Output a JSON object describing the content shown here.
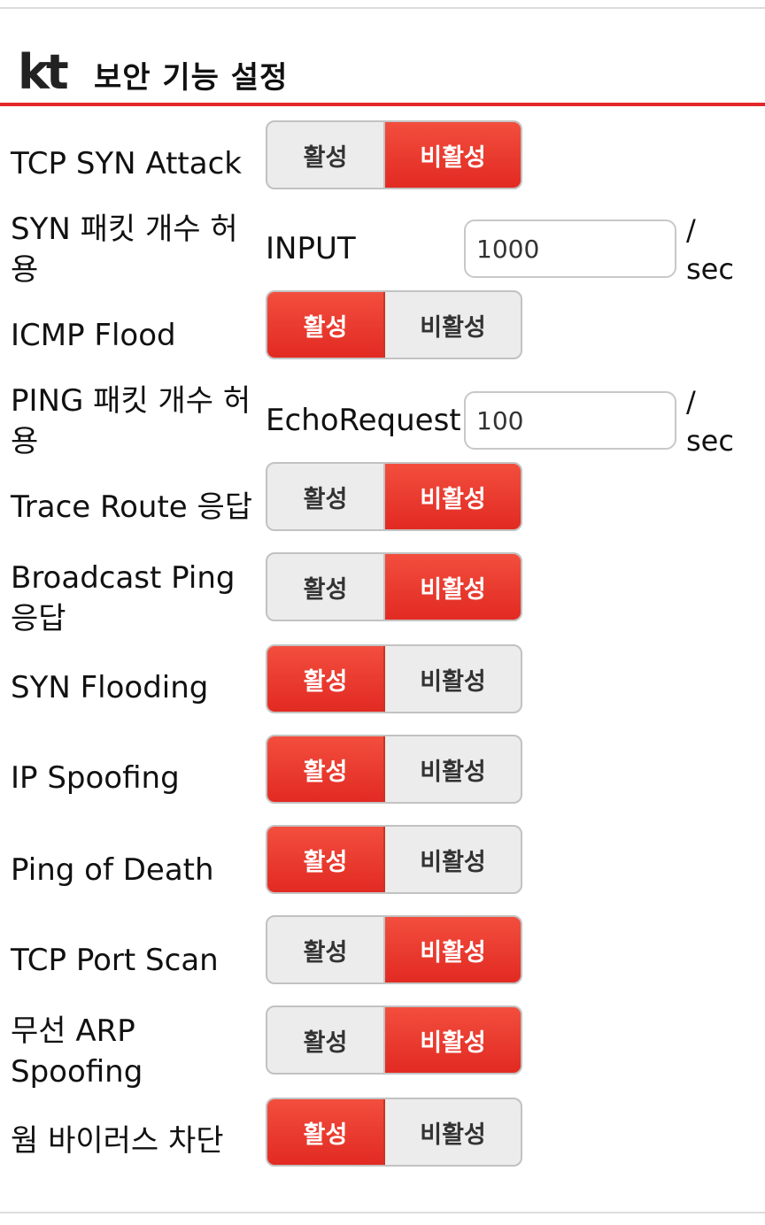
{
  "header": {
    "logo_text": "kt",
    "title": "보안 기능 설정"
  },
  "colors": {
    "accent": "#e3262b",
    "segment_bg": "#ececec"
  },
  "rows": [
    {
      "label": "TCP SYN Attack",
      "on": "활성",
      "off": "비활성",
      "selected": "off"
    },
    {
      "label": "SYN 패킷 개수 허용",
      "type_text": "INPUT",
      "value": "1000",
      "unit": "/ sec"
    },
    {
      "label": "ICMP Flood",
      "on": "활성",
      "off": "비활성",
      "selected": "on"
    },
    {
      "label": "PING 패킷 개수 허용",
      "type_text": "EchoRequest",
      "value": "100",
      "unit": "/ sec"
    },
    {
      "label": "Trace Route 응답",
      "on": "활성",
      "off": "비활성",
      "selected": "off"
    },
    {
      "label": "Broadcast Ping 응답",
      "on": "활성",
      "off": "비활성",
      "selected": "off"
    },
    {
      "label": "SYN Flooding",
      "on": "활성",
      "off": "비활성",
      "selected": "on"
    },
    {
      "label": "IP Spoofing",
      "on": "활성",
      "off": "비활성",
      "selected": "on"
    },
    {
      "label": "Ping of Death",
      "on": "활성",
      "off": "비활성",
      "selected": "on"
    },
    {
      "label": "TCP Port Scan",
      "on": "활성",
      "off": "비활성",
      "selected": "off"
    },
    {
      "label": "무선 ARP Spoofing",
      "on": "활성",
      "off": "비활성",
      "selected": "off"
    },
    {
      "label": "웜 바이러스 차단",
      "on": "활성",
      "off": "비활성",
      "selected": "on"
    }
  ]
}
